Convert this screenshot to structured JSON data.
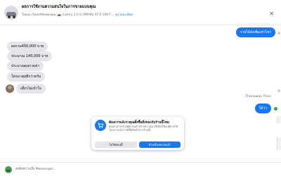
{
  "header": {
    "title": "ผลการใช้งานความสนใจในการขายแบบคุณ",
    "ad_label": "โฆษณาโดยบริษัทของคุณ",
    "vehicle": "Camry 2.0 G (MY06) AT ปี 2007...",
    "details_link": "ดูรายละเอียด",
    "close_icon": "✕"
  },
  "messages": [
    {
      "side": "out",
      "text": "รายได้ส่งเพิ่มเท่าไหร่"
    },
    {
      "side": "in",
      "text": "ผลรวม450,000 บาท"
    },
    {
      "side": "in",
      "text": "ประมาณ 140,000 บาท"
    },
    {
      "side": "in",
      "text": "ประมาณผลรวมค่า"
    },
    {
      "side": "in",
      "text": "โทรมาคุยทีกว่าครับ"
    },
    {
      "side": "in",
      "text": "เดี๋ยวไม่เข้าใจ"
    },
    {
      "side": "out",
      "text": "ได้ว่า",
      "sender": "Thanawan Thon"
    }
  ],
  "prompt": {
    "title": "ต้องการแจ้งว่าคุณตั้งซื้อสิ่งของกับร้านนี้ไหม",
    "body": "คุณสามารถช่วยผู้ขายแล้วสร้างความน่าเชื่อถือให้แก่ผู้ขายได้ โดยการแจ้งว่าได้ซื้อสินค้าจากร้านนี้",
    "secondary_button": "ไม่ใช่ตอนนี้",
    "primary_button": "ทำเครื่องหมายแล้ว"
  },
  "composer": {
    "placeholder": "ส่งข้อความถึง Messenger..."
  },
  "colors": {
    "accent": "#1877f2",
    "bubble_in": "#e4e6eb",
    "online": "#31a24c"
  }
}
